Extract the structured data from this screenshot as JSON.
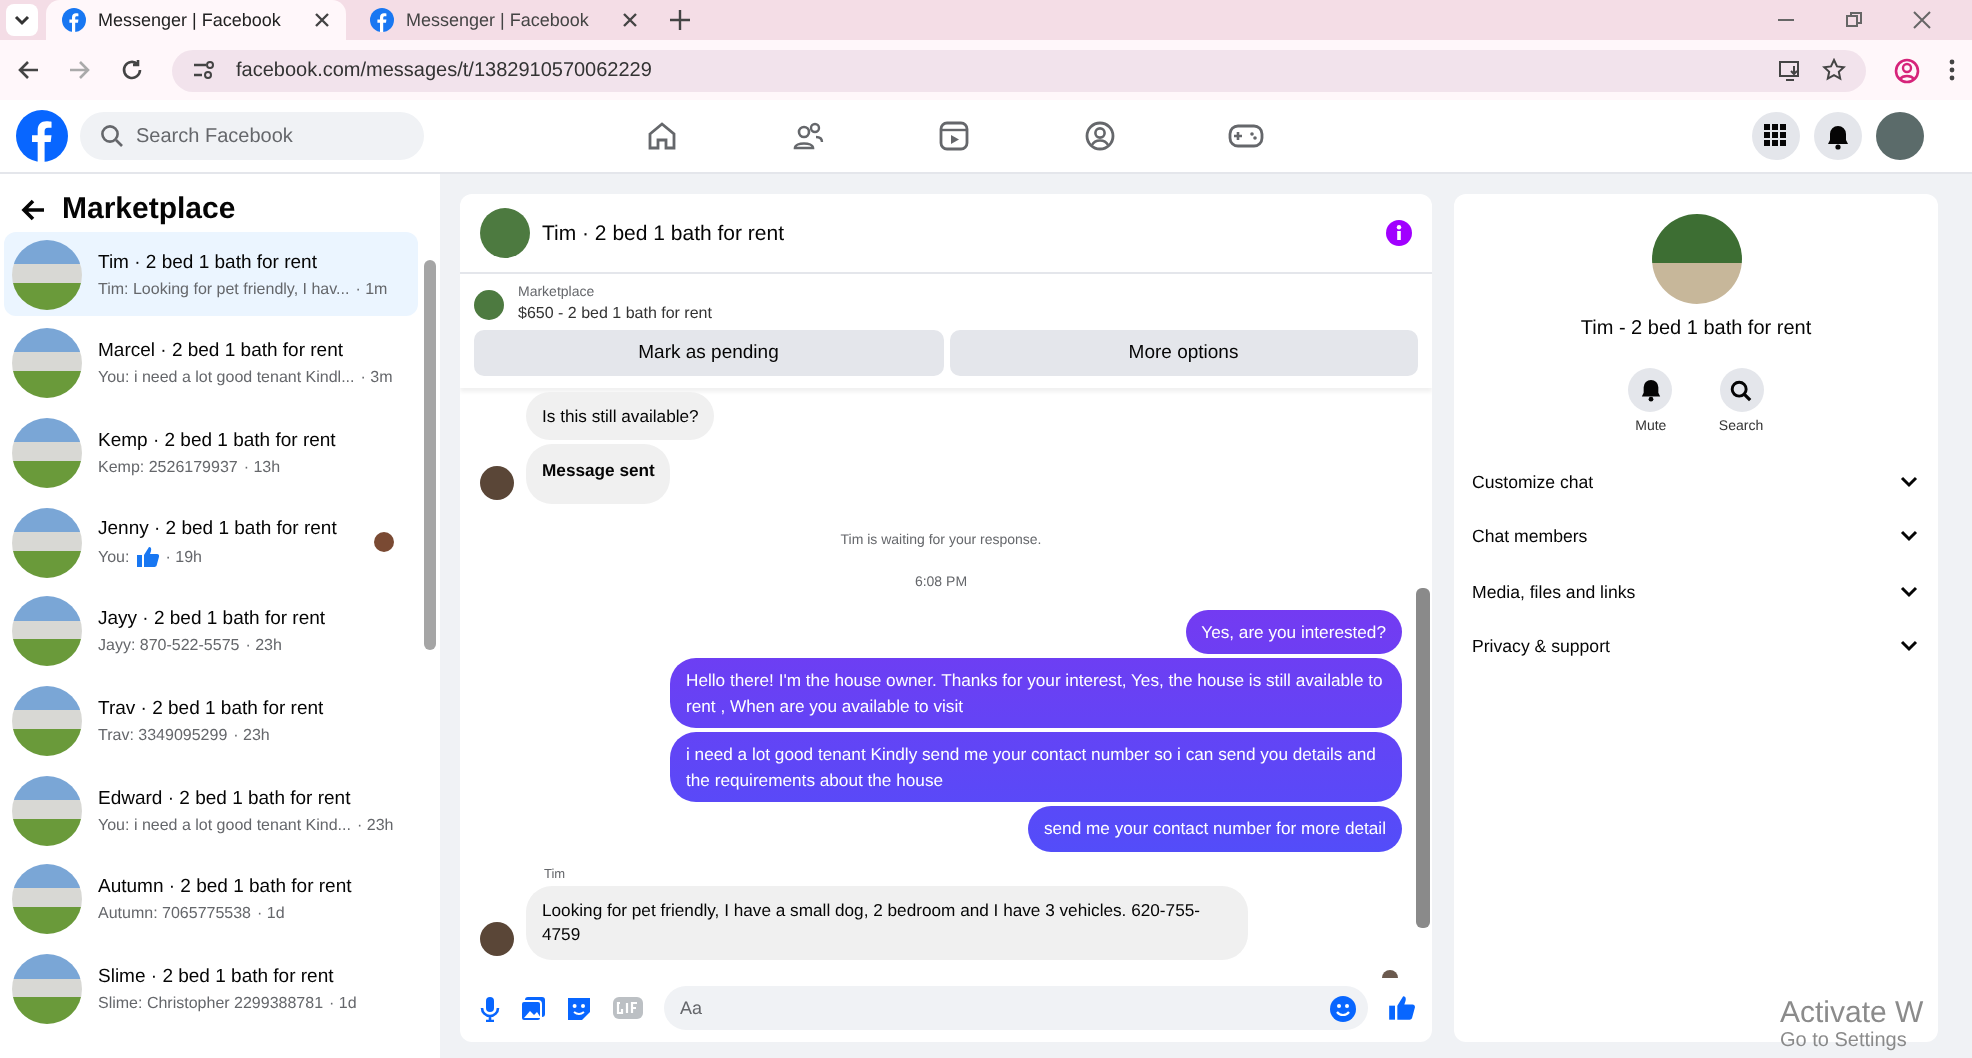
{
  "browser": {
    "tabs": [
      {
        "title": "Messenger | Facebook",
        "selected": true
      },
      {
        "title": "Messenger | Facebook",
        "selected": false
      }
    ],
    "url": "facebook.com/messages/t/1382910570062229"
  },
  "header": {
    "search": {
      "placeholder": "Search Facebook"
    },
    "nav": [
      {
        "kind": "home"
      },
      {
        "kind": "friends"
      },
      {
        "kind": "video"
      },
      {
        "kind": "groups"
      },
      {
        "kind": "gaming"
      }
    ]
  },
  "sidebar": {
    "title": "Marketplace",
    "conversations": [
      {
        "name": "Tim · 2 bed 1 bath for rent",
        "preview": "Tim: Looking for pet friendly, I hav...",
        "like": false,
        "time": "· 1m",
        "seen": false,
        "selected": true
      },
      {
        "name": "Marcel · 2 bed 1 bath for rent",
        "preview": "You: i need a lot good tenant Kindl...",
        "like": false,
        "time": "· 3m",
        "seen": false,
        "selected": false
      },
      {
        "name": "Kemp · 2 bed 1 bath for rent",
        "preview": "Kemp: 2526179937",
        "like": false,
        "time": "· 13h",
        "seen": false,
        "selected": false
      },
      {
        "name": "Jenny · 2 bed 1 bath for rent",
        "preview": "You:",
        "like": true,
        "time": "· 19h",
        "seen": true,
        "selected": false
      },
      {
        "name": "Jayy · 2 bed 1 bath for rent",
        "preview": "Jayy: 870-522-5575",
        "like": false,
        "time": "· 23h",
        "seen": false,
        "selected": false
      },
      {
        "name": "Trav · 2 bed 1 bath for rent",
        "preview": "Trav: 3349095299",
        "like": false,
        "time": "· 23h",
        "seen": false,
        "selected": false
      },
      {
        "name": "Edward · 2 bed 1 bath for rent",
        "preview": "You: i need a lot good tenant Kind...",
        "like": false,
        "time": "· 23h",
        "seen": false,
        "selected": false
      },
      {
        "name": "Autumn · 2 bed 1 bath for rent",
        "preview": "Autumn: 7065775538",
        "like": false,
        "time": "· 1d",
        "seen": false,
        "selected": false
      },
      {
        "name": "Slime · 2 bed 1 bath for rent",
        "preview": "Slime: Christopher 2299388781",
        "like": false,
        "time": "· 1d",
        "seen": false,
        "selected": false
      }
    ]
  },
  "chat": {
    "title": "Tim · 2 bed 1 bath for rent",
    "listing": {
      "label": "Marketplace",
      "title": "$650 - 2 bed 1 bath for rent"
    },
    "actions": [
      "Mark as pending",
      "More options"
    ],
    "messages": [
      {
        "kind": "incoming",
        "text": "Is this still available?",
        "bold": false,
        "avatar": false
      },
      {
        "kind": "incoming",
        "text": "Message sent",
        "bold": true,
        "avatar": true
      },
      {
        "kind": "status",
        "text": "Tim is waiting for your response."
      },
      {
        "kind": "time",
        "text": "6:08 PM"
      },
      {
        "kind": "outgoing",
        "text": "Yes, are you interested?"
      },
      {
        "kind": "outgoing",
        "text": "Hello there! I'm the house owner. Thanks for your interest, Yes, the house is still available to rent , When are you available to visit"
      },
      {
        "kind": "outgoing",
        "text": "i need a lot good tenant Kindly send me your contact number so i can send you details and the requirements about the house"
      },
      {
        "kind": "outgoing",
        "text": "send me your contact number for more detail"
      },
      {
        "kind": "sender",
        "text": "Tim"
      },
      {
        "kind": "incoming",
        "text": "Looking for pet friendly, I have a small dog, 2 bedroom and I have 3 vehicles.   620-755-4759",
        "bold": false,
        "avatar": true
      }
    ],
    "composer": {
      "placeholder": "Aa"
    }
  },
  "details": {
    "title": "Tim - 2 bed 1 bath for rent",
    "actions": [
      {
        "kind": "mute",
        "label": "Mute"
      },
      {
        "kind": "search",
        "label": "Search"
      }
    ],
    "sections": [
      "Customize chat",
      "Chat members",
      "Media, files and links",
      "Privacy & support"
    ]
  },
  "os_notice": [
    "Activate W",
    "Go to Settings"
  ]
}
